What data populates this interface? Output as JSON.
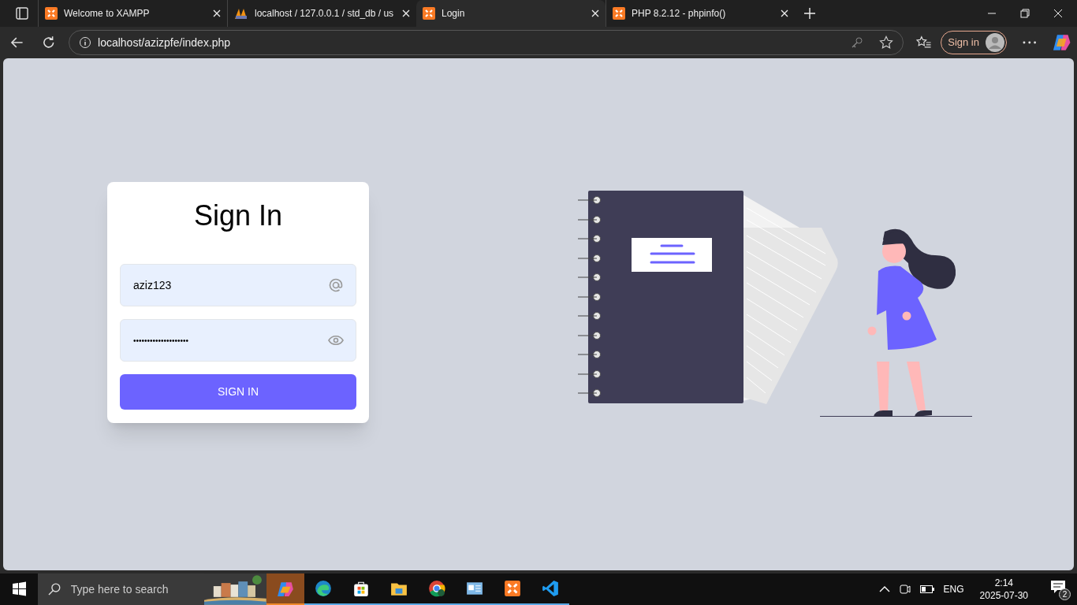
{
  "tabs": [
    {
      "kind": "xampp",
      "title": "Welcome to XAMPP",
      "selected": false
    },
    {
      "kind": "pma",
      "title": "localhost / 127.0.0.1 / std_db / us",
      "selected": false
    },
    {
      "kind": "xampp",
      "title": "Login",
      "selected": true
    },
    {
      "kind": "xampp",
      "title": "PHP 8.2.12 - phpinfo()",
      "selected": false
    }
  ],
  "address_bar": {
    "url": "localhost/azizpfe/index.php"
  },
  "profile_button": {
    "label": "Sign in"
  },
  "login_card": {
    "title": "Sign In",
    "username": "aziz123",
    "password": "••••••••••••••••••••",
    "button": "SIGN IN"
  },
  "taskbar": {
    "search_placeholder": "Type here to search",
    "apps": [
      {
        "kind": "copilot",
        "running": false,
        "selected": true
      },
      {
        "kind": "edge",
        "running": true,
        "selected": false
      },
      {
        "kind": "store",
        "running": true,
        "selected": false
      },
      {
        "kind": "explorer",
        "running": true,
        "selected": false
      },
      {
        "kind": "chrome",
        "running": true,
        "selected": false
      },
      {
        "kind": "control",
        "running": true,
        "selected": false
      },
      {
        "kind": "xampp",
        "running": true,
        "selected": false
      },
      {
        "kind": "vscode",
        "running": true,
        "selected": false
      }
    ],
    "language": "ENG",
    "time": "2:14",
    "date": "2025-07-30",
    "notifications": "2"
  }
}
